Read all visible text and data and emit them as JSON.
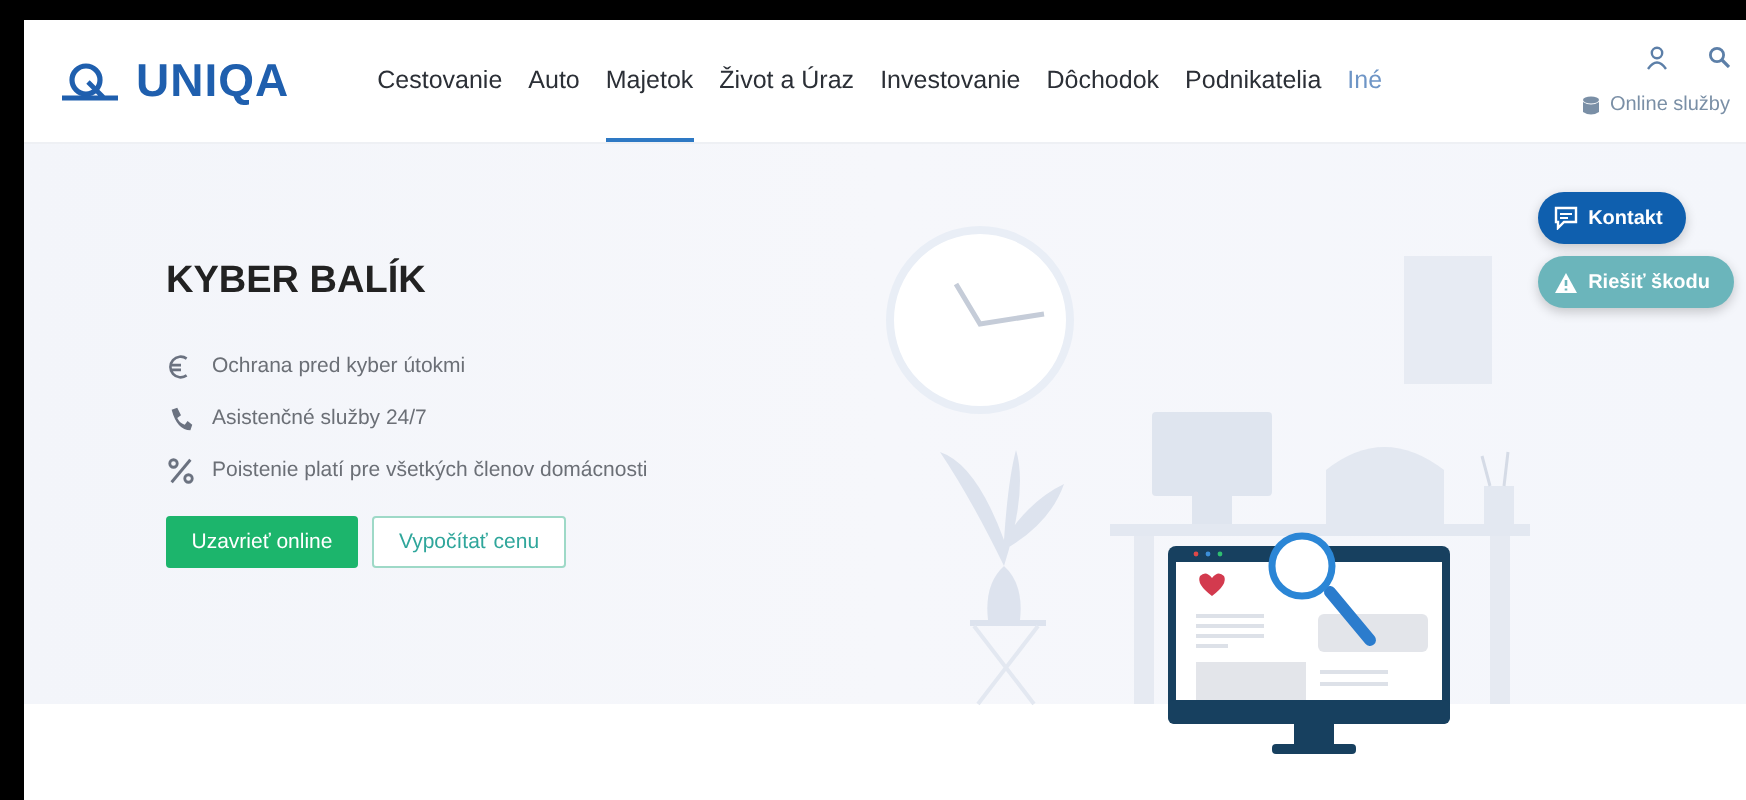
{
  "header": {
    "logo": "UNIQA",
    "nav": [
      {
        "label": "Cestovanie",
        "selected": false,
        "kind": "link"
      },
      {
        "label": "Auto",
        "selected": false,
        "kind": "link"
      },
      {
        "label": "Majetok",
        "selected": true,
        "kind": "link"
      },
      {
        "label": "Život a Úraz",
        "selected": false,
        "kind": "link"
      },
      {
        "label": "Investovanie",
        "selected": false,
        "kind": "link"
      },
      {
        "label": "Dôchodok",
        "selected": false,
        "kind": "link"
      },
      {
        "label": "Podnikatelia",
        "selected": false,
        "kind": "link"
      },
      {
        "label": "Iné",
        "selected": false,
        "kind": "more"
      }
    ],
    "online_services": "Online služby"
  },
  "hero": {
    "title": "KYBER BALÍK",
    "features": [
      "Ochrana pred kyber útokmi",
      "Asistenčné služby 24/7",
      "Poistenie platí pre všetkých členov domácnosti"
    ],
    "primary_button": "Uzavrieť online",
    "secondary_button": "Vypočítať cenu"
  },
  "floating_buttons": [
    {
      "label": "Kontakt",
      "kind": "contact"
    },
    {
      "label": "Riešiť škodu",
      "kind": "claim"
    }
  ]
}
